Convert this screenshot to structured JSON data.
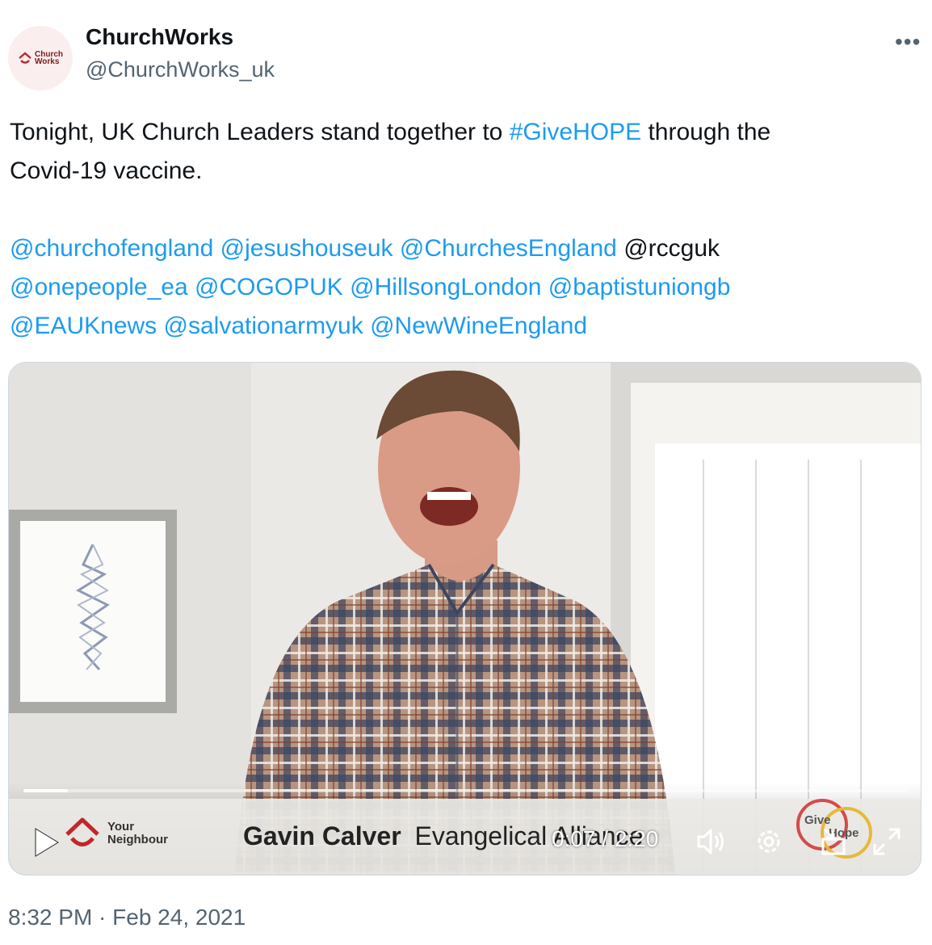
{
  "author": {
    "name": "ChurchWorks",
    "handle": "@ChurchWorks_uk",
    "avatar_text": [
      "Church",
      "Works"
    ]
  },
  "tweet": {
    "line1_pre": "Tonight, UK Church Leaders stand together to ",
    "hashtag": "#GiveHOPE",
    "line1_post": " through the",
    "line2": "Covid-19 vaccine.",
    "mentions_row1": [
      "@churchofengland",
      "@jesushouseuk",
      "@ChurchesEngland"
    ],
    "plain_mention": "@rccguk",
    "mentions_row2": [
      "@onepeople_ea",
      "@COGOPUK",
      "@HillsongLondon",
      "@baptistuniongb"
    ],
    "mentions_row3": [
      "@EAUKnews",
      "@salvationarmyuk",
      "@NewWineEngland"
    ]
  },
  "video": {
    "logo_text": [
      "Your",
      "Neighbour"
    ],
    "speaker_name": "Gavin Calver",
    "speaker_org": "Evangelical Alliance",
    "time_current": "0:07",
    "time_sep": " / ",
    "time_total": "2:20",
    "progress": 0.05,
    "badge_text": [
      "Give",
      "Hope"
    ]
  },
  "timestamp": "8:32 PM · Feb 24, 2021",
  "colors": {
    "link": "#1d9bf0",
    "text": "#0f1419",
    "muted": "#536471"
  }
}
